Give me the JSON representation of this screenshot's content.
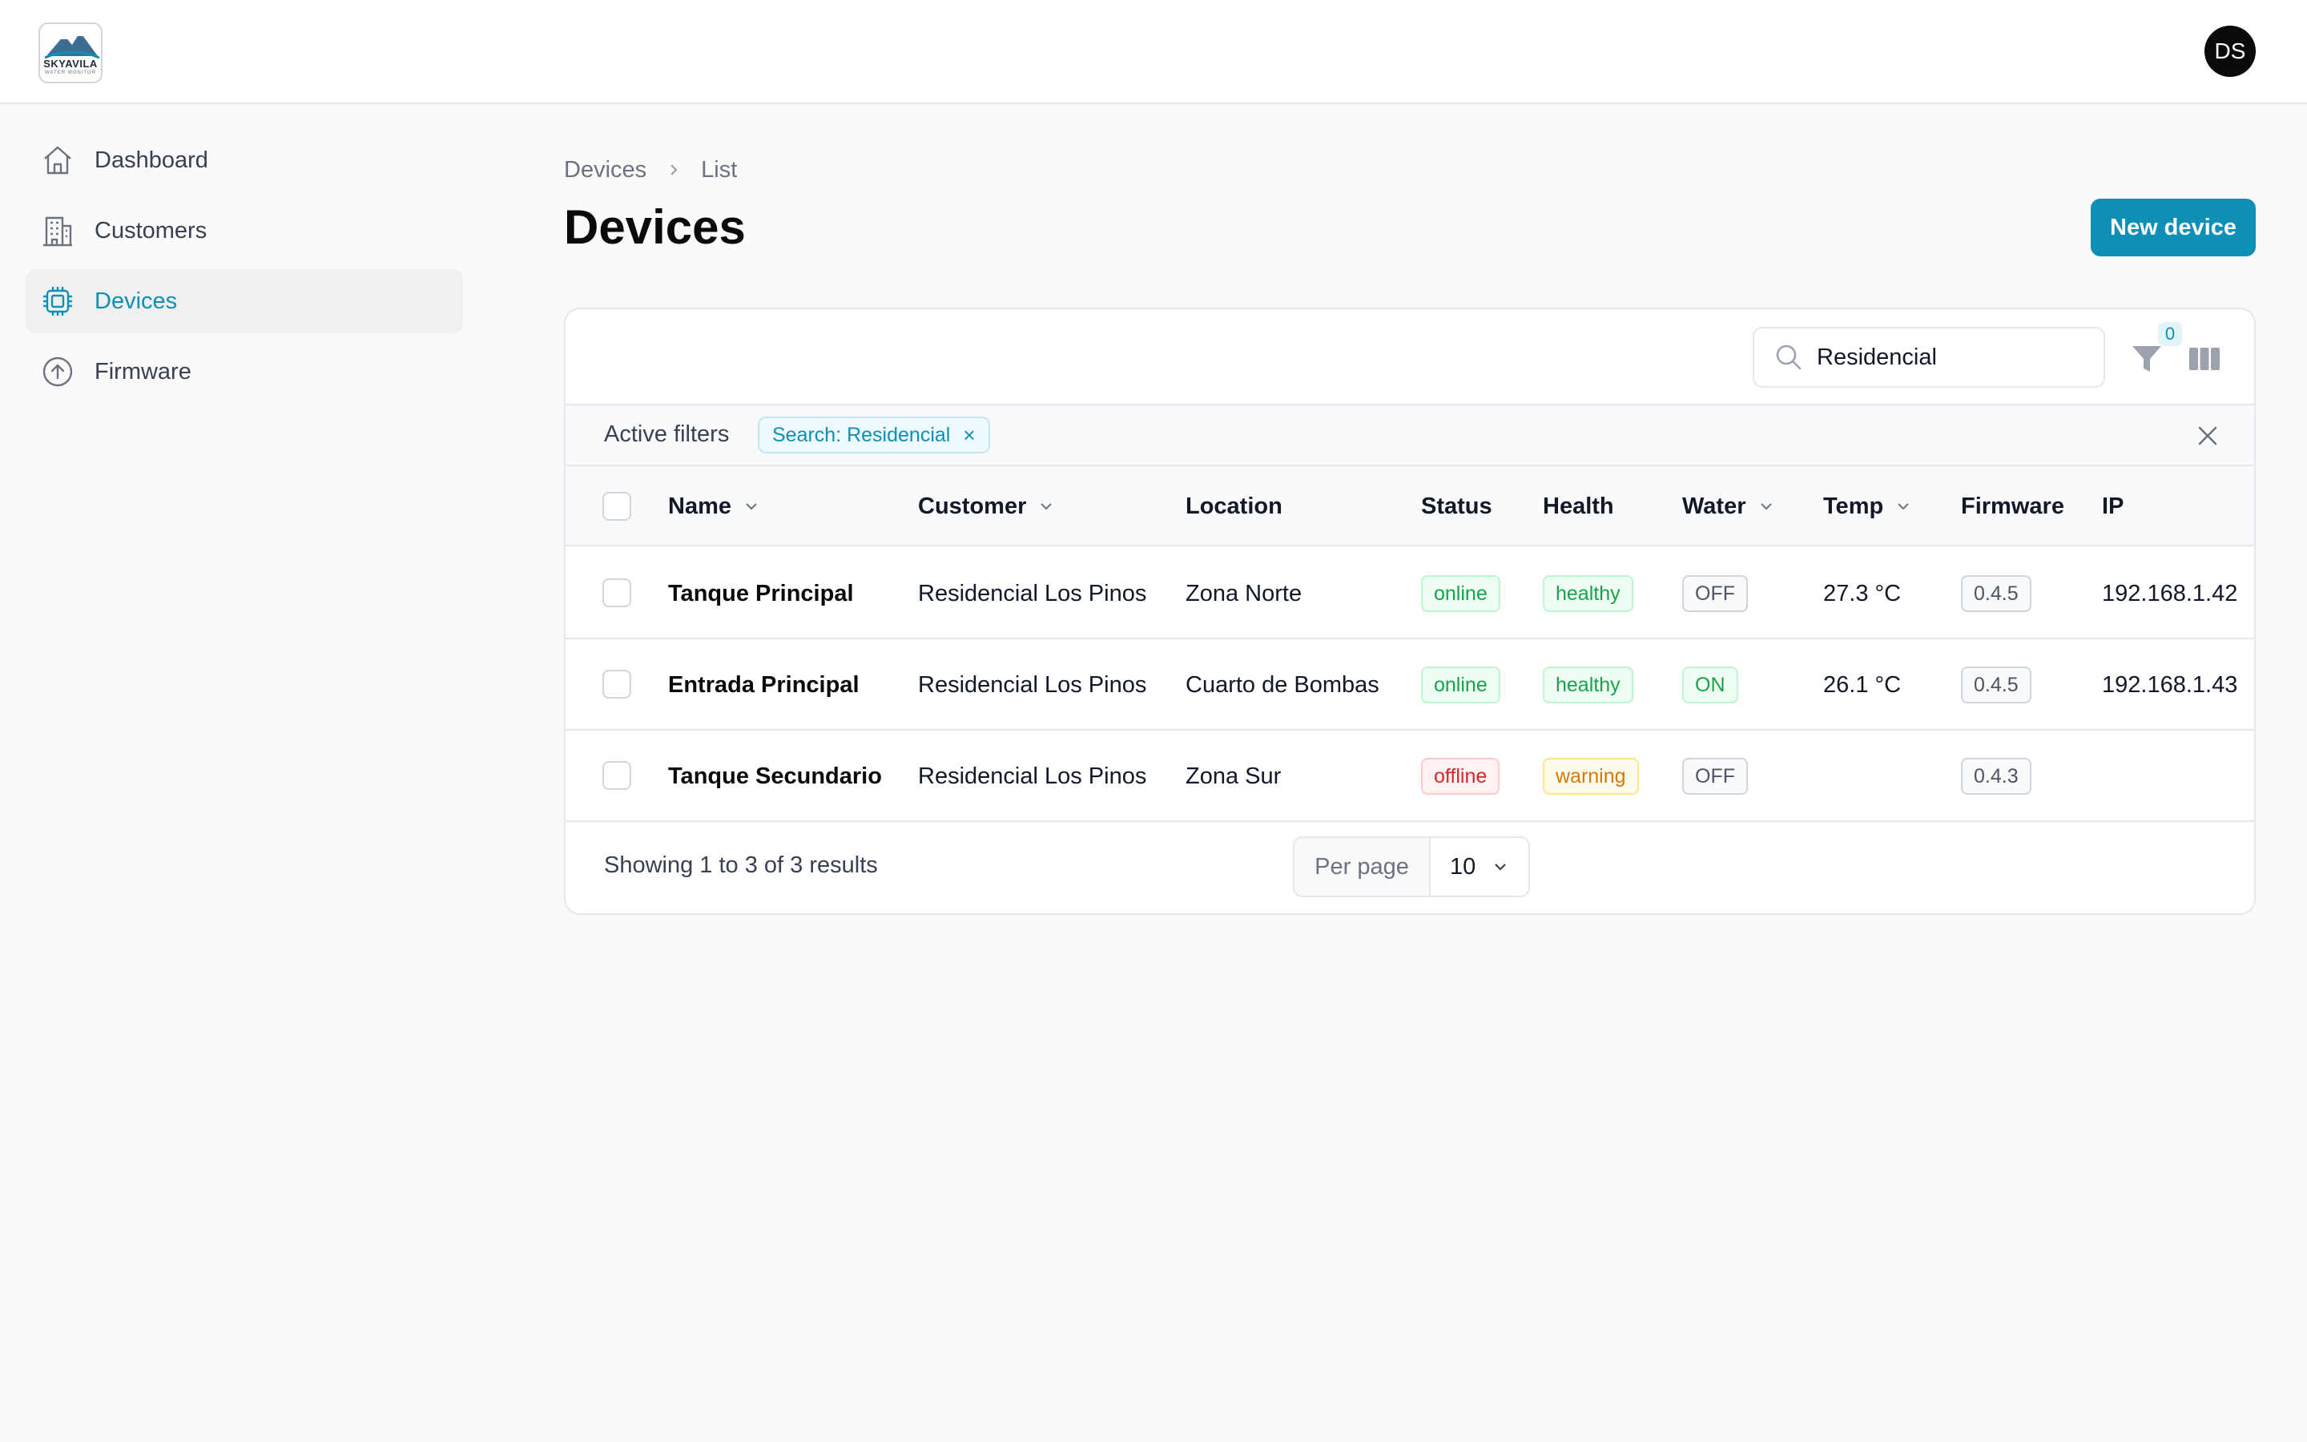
{
  "brand": {
    "logo_text": "SKYAVILA",
    "logo_sub": "WATER MONITOR"
  },
  "user": {
    "initials": "DS"
  },
  "sidebar": {
    "items": [
      {
        "label": "Dashboard",
        "icon": "home-icon"
      },
      {
        "label": "Customers",
        "icon": "building-icon"
      },
      {
        "label": "Devices",
        "icon": "chip-icon",
        "active": true
      },
      {
        "label": "Firmware",
        "icon": "upload-circle-icon"
      }
    ]
  },
  "breadcrumb": {
    "parent": "Devices",
    "current": "List"
  },
  "page": {
    "title": "Devices",
    "new_button": "New device"
  },
  "toolbar": {
    "search_value": "Residencial",
    "filter_count": "0"
  },
  "filters": {
    "label": "Active filters",
    "chip": "Search: Residencial",
    "chip_remove": "×"
  },
  "table": {
    "columns": {
      "name": "Name",
      "customer": "Customer",
      "location": "Location",
      "status": "Status",
      "health": "Health",
      "water": "Water",
      "temp": "Temp",
      "firmware": "Firmware",
      "ip": "IP"
    },
    "rows": [
      {
        "name": "Tanque Principal",
        "customer": "Residencial Los Pinos",
        "location": "Zona Norte",
        "status": "online",
        "health": "healthy",
        "water": "OFF",
        "temp": "27.3 °C",
        "firmware": "0.4.5",
        "ip": "192.168.1.42"
      },
      {
        "name": "Entrada Principal",
        "customer": "Residencial Los Pinos",
        "location": "Cuarto de Bombas",
        "status": "online",
        "health": "healthy",
        "water": "ON",
        "temp": "26.1 °C",
        "firmware": "0.4.5",
        "ip": "192.168.1.43"
      },
      {
        "name": "Tanque Secundario",
        "customer": "Residencial Los Pinos",
        "location": "Zona Sur",
        "status": "offline",
        "health": "warning",
        "water": "OFF",
        "temp": "",
        "firmware": "0.4.3",
        "ip": ""
      }
    ]
  },
  "footer": {
    "results": "Showing 1 to 3 of 3 results",
    "per_page_label": "Per page",
    "per_page_value": "10"
  },
  "colors": {
    "accent": "#0e8fb6",
    "online": "#16a34a",
    "offline": "#dc2626",
    "warning": "#d97706"
  }
}
